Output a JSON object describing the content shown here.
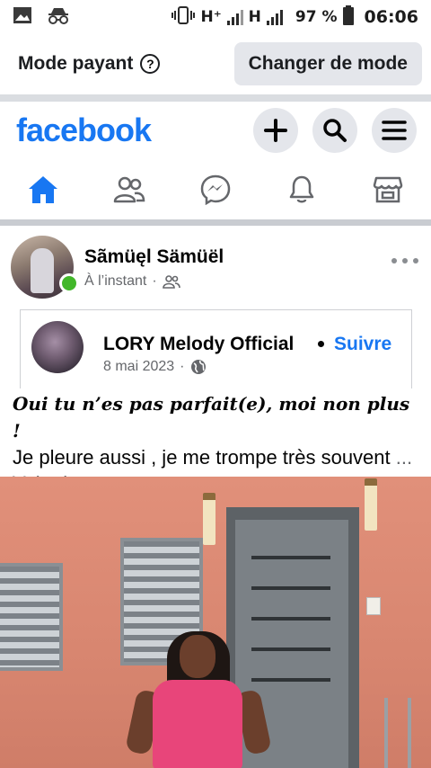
{
  "status_bar": {
    "network_1": "H⁺",
    "network_2": "H",
    "battery": "97 %",
    "time": "06:06",
    "icons": [
      "image-icon",
      "incognito-icon",
      "vibrate-icon",
      "signal-icon",
      "battery-icon"
    ]
  },
  "mode_bar": {
    "label": "Mode payant",
    "help": "?",
    "button": "Changer de mode"
  },
  "header": {
    "logo": "facebook",
    "icons": [
      "plus-icon",
      "search-icon",
      "menu-icon"
    ]
  },
  "tabs": [
    {
      "name": "home",
      "icon": "home-icon",
      "active": true
    },
    {
      "name": "friends",
      "icon": "friends-icon",
      "active": false
    },
    {
      "name": "messenger",
      "icon": "messenger-icon",
      "active": false
    },
    {
      "name": "notifications",
      "icon": "bell-icon",
      "active": false
    },
    {
      "name": "marketplace",
      "icon": "store-icon",
      "active": false
    }
  ],
  "post": {
    "author": "Sãmüęl Sämüël",
    "time": "À l’instant",
    "privacy_icon": "friends-icon",
    "shared": {
      "name": "LORY Melody Official",
      "follow": "Suivre",
      "date": "8 mai 2023",
      "privacy_icon": "globe-icon"
    },
    "text_styled": "𝑶𝒖𝒊 𝒕𝒖 𝒏’𝒆𝒔 𝒑𝒂𝒔 𝒑𝒂𝒓𝒇𝒂𝒊𝒕(𝒆), 𝒎𝒐𝒊 𝒏𝒐𝒏 𝒑𝒍𝒖𝒔 !",
    "text_plain": "Je pleure aussi , je me trompe très souvent",
    "see_more": "... Voir plus"
  },
  "colors": {
    "brand": "#1877f2",
    "online": "#42b72a",
    "secondary_text": "#65676b"
  }
}
